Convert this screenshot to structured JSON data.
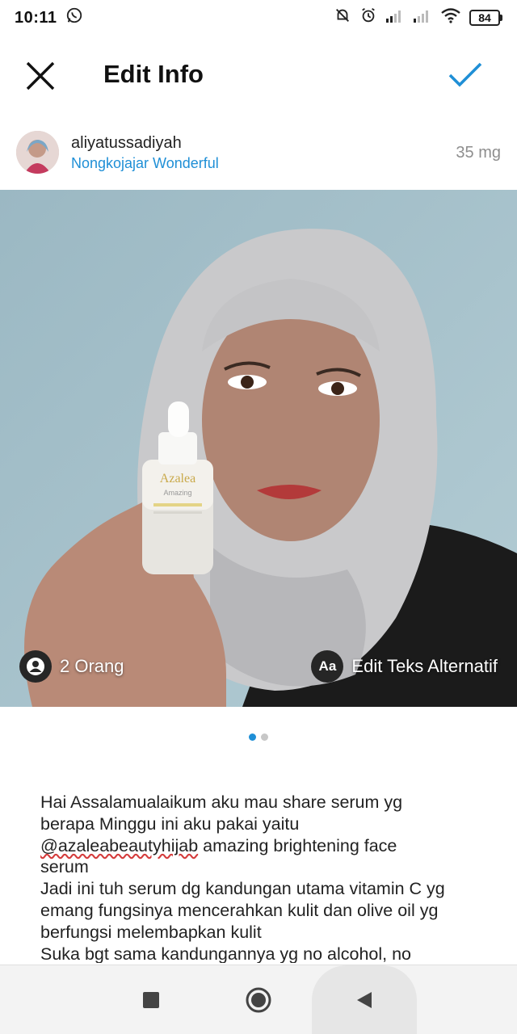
{
  "status_bar": {
    "time": "10:11",
    "battery": "84"
  },
  "header": {
    "title": "Edit Info"
  },
  "post": {
    "username": "aliyatussadiyah",
    "location": "Nongkojajar Wonderful",
    "time_ago": "35 mg",
    "product_brand": "Azalea",
    "product_line": "Amazing",
    "tag_label": "2 Orang",
    "alt_text_icon": "Aa",
    "alt_text_label": "Edit Teks Alternatif",
    "page_count": 2,
    "current_page": 1
  },
  "caption": {
    "line1": "Hai Assalamualaikum aku mau share serum yg\nberapa Minggu ini aku pakai yaitu\n",
    "mention": "@azaleabeautyhijab",
    "line2": " amazing brightening face\nserum\nJadi ini tuh serum dg kandungan utama vitamin C yg\nemang fungsinya mencerahkan kulit dan olive oil yg\nberfungsi melembapkan kulit\nSuka bgt sama kandungannya yg no alcohol, no"
  },
  "colors": {
    "accent": "#1f8fd6",
    "photo_bg": "#a8c2cc",
    "mention_underline": "#d43c3c"
  },
  "icons": {
    "close": "close-icon",
    "done": "checkmark-icon",
    "tag": "person-icon",
    "nav_recent": "square-icon",
    "nav_home": "circle-icon",
    "nav_back": "triangle-back-icon"
  }
}
